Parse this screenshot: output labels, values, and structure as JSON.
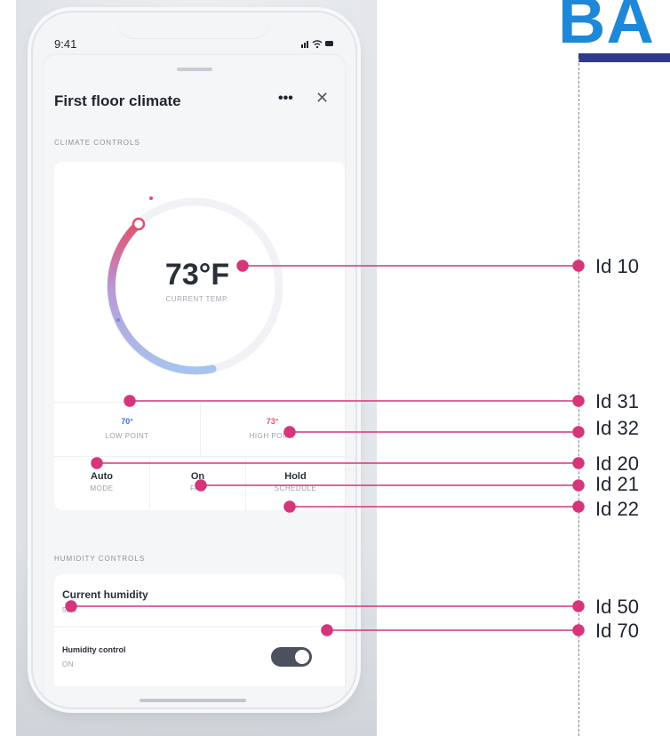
{
  "status": {
    "time": "9:41",
    "icons": "..ıl ≈ ▬"
  },
  "panel": {
    "title": "First floor climate",
    "more_icon": "•••",
    "close_icon": "✕",
    "climate_section": "CLIMATE CONTROLS",
    "current_temp": "73°F",
    "current_temp_label": "CURRENT TEMP.",
    "low_point": {
      "value": "70°",
      "label": "LOW POINT"
    },
    "high_point": {
      "value": "73°",
      "label": "HIGH POINT"
    },
    "mode": {
      "value": "Auto",
      "label": "MODE"
    },
    "fan": {
      "value": "On",
      "label": "FAN"
    },
    "schedule": {
      "value": "Hold",
      "label": "SCHEDULE"
    },
    "humidity_section": "HUMIDITY CONTROLS",
    "current_humidity": {
      "title": "Current humidity",
      "value": "56%"
    },
    "humidity_control": {
      "title": "Humidity control",
      "value": "ON",
      "enabled": true
    }
  },
  "brand_text": "BA",
  "callouts": [
    "Id 10",
    "Id 31",
    "Id 32",
    "Id 20",
    "Id 21",
    "Id 22",
    "Id 50",
    "Id 70"
  ],
  "colors": {
    "accent": "#d6357a",
    "low": "#3a6fd8",
    "high": "#e2506d",
    "brand": "#1e88d8",
    "toggle": "#4c5160"
  }
}
